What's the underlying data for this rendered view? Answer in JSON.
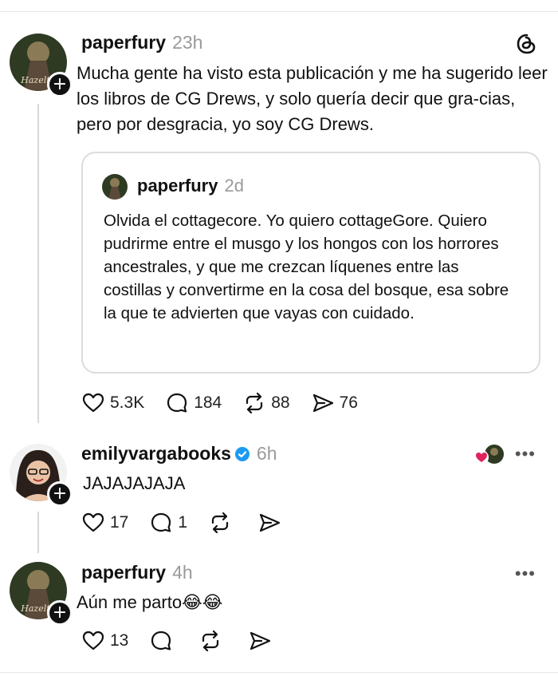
{
  "app": {
    "logo_icon": "threads-icon"
  },
  "posts": [
    {
      "username": "paperfury",
      "time": "23h",
      "avatar_text": "Hazelth",
      "text": "Mucha gente ha visto esta publicación y me ha sugerido leer los libros de CG Drews, y solo quería decir que gra-cias, pero por desgracia, yo soy CG Drews.",
      "quote": {
        "username": "paperfury",
        "time": "2d",
        "text": "Olvida el cottagecore. Yo quiero cottageGore. Quiero pudrirme entre el musgo y los hongos con los horrores ancestrales, y que me crezcan líquenes entre las costillas y convertirme en la cosa del bosque, esa sobre la que te advierten que vayas con cuidado."
      },
      "likes": "5.3K",
      "replies": "184",
      "reposts": "88",
      "shares": "76"
    },
    {
      "username": "emilyvargabooks",
      "time": "6h",
      "verified": true,
      "text": "JAJAJAJAJA",
      "likes": "17",
      "replies": "1"
    },
    {
      "username": "paperfury",
      "time": "4h",
      "avatar_text": "Hazelth",
      "text": "Aún me parto😂😂",
      "likes": "13"
    }
  ],
  "colors": {
    "verified": "#1d9bf0",
    "heart": "#e0245e",
    "muted": "#9a9a9a"
  }
}
